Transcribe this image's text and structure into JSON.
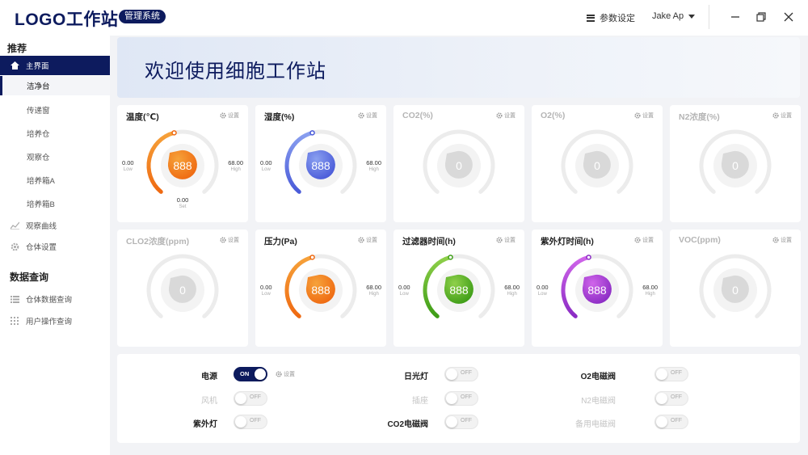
{
  "header": {
    "logo": "LOGO工作站",
    "badge": "管理系统",
    "settings_label": "参数设定",
    "user_name": "Jake Ap"
  },
  "sidebar": {
    "section1": "推荐",
    "main_item": "主界面",
    "items": [
      "洁净台",
      "传递窗",
      "培养仓",
      "观察仓",
      "培养箱A",
      "培养箱B"
    ],
    "curve": "观察曲线",
    "cabin_settings": "仓体设置",
    "section2": "数据查询",
    "query_items": [
      "仓体数据查询",
      "用户操作查询"
    ]
  },
  "banner": {
    "title": "欢迎使用细胞工作站"
  },
  "set_label": "设置",
  "sub_labels": {
    "low": "Low",
    "high": "High",
    "set": "Set"
  },
  "colors": {
    "accent": "#0d1b5e",
    "orange": "#f08a1c",
    "blue": "#5b6ee0",
    "green": "#5cb82a",
    "purple": "#b03ad0",
    "inactive": "#d9d9d9"
  },
  "cards": [
    {
      "title": "温度(℃)",
      "active": true,
      "color": "orange",
      "value": "888",
      "low": "0.00",
      "high": "68.00",
      "set": "0.00"
    },
    {
      "title": "湿度(%)",
      "active": true,
      "color": "blue",
      "value": "888",
      "low": "0.00",
      "high": "68.00"
    },
    {
      "title": "CO2(%)",
      "active": false,
      "value": "0"
    },
    {
      "title": "O2(%)",
      "active": false,
      "value": "0"
    },
    {
      "title": "N2浓度(%)",
      "active": false,
      "value": "0"
    },
    {
      "title": "CLO2浓度(ppm)",
      "active": false,
      "value": "0"
    },
    {
      "title": "压力(Pa)",
      "active": true,
      "color": "orange",
      "value": "888",
      "low": "0.00",
      "high": "68.00"
    },
    {
      "title": "过滤器时间(h)",
      "active": true,
      "color": "green",
      "value": "888",
      "low": "0.00",
      "high": "68.00"
    },
    {
      "title": "紫外灯时间(h)",
      "active": true,
      "color": "purple",
      "value": "888",
      "low": "0.00",
      "high": "68.00"
    },
    {
      "title": "VOC(ppm)",
      "active": false,
      "value": "0"
    }
  ],
  "controls": [
    {
      "label": "电源",
      "state": "ON",
      "on": true,
      "enabled": true,
      "has_set": true
    },
    {
      "label": "日光灯",
      "state": "OFF",
      "on": false,
      "enabled": true
    },
    {
      "label": "O2电磁阀",
      "state": "OFF",
      "on": false,
      "enabled": true
    },
    {
      "label": "风机",
      "state": "OFF",
      "on": false,
      "enabled": false
    },
    {
      "label": "插座",
      "state": "OFF",
      "on": false,
      "enabled": false
    },
    {
      "label": "N2电磁阀",
      "state": "OFF",
      "on": false,
      "enabled": false
    },
    {
      "label": "紫外灯",
      "state": "OFF",
      "on": false,
      "enabled": true
    },
    {
      "label": "CO2电磁阀",
      "state": "OFF",
      "on": false,
      "enabled": true
    },
    {
      "label": "备用电磁阀",
      "state": "OFF",
      "on": false,
      "enabled": false
    }
  ]
}
